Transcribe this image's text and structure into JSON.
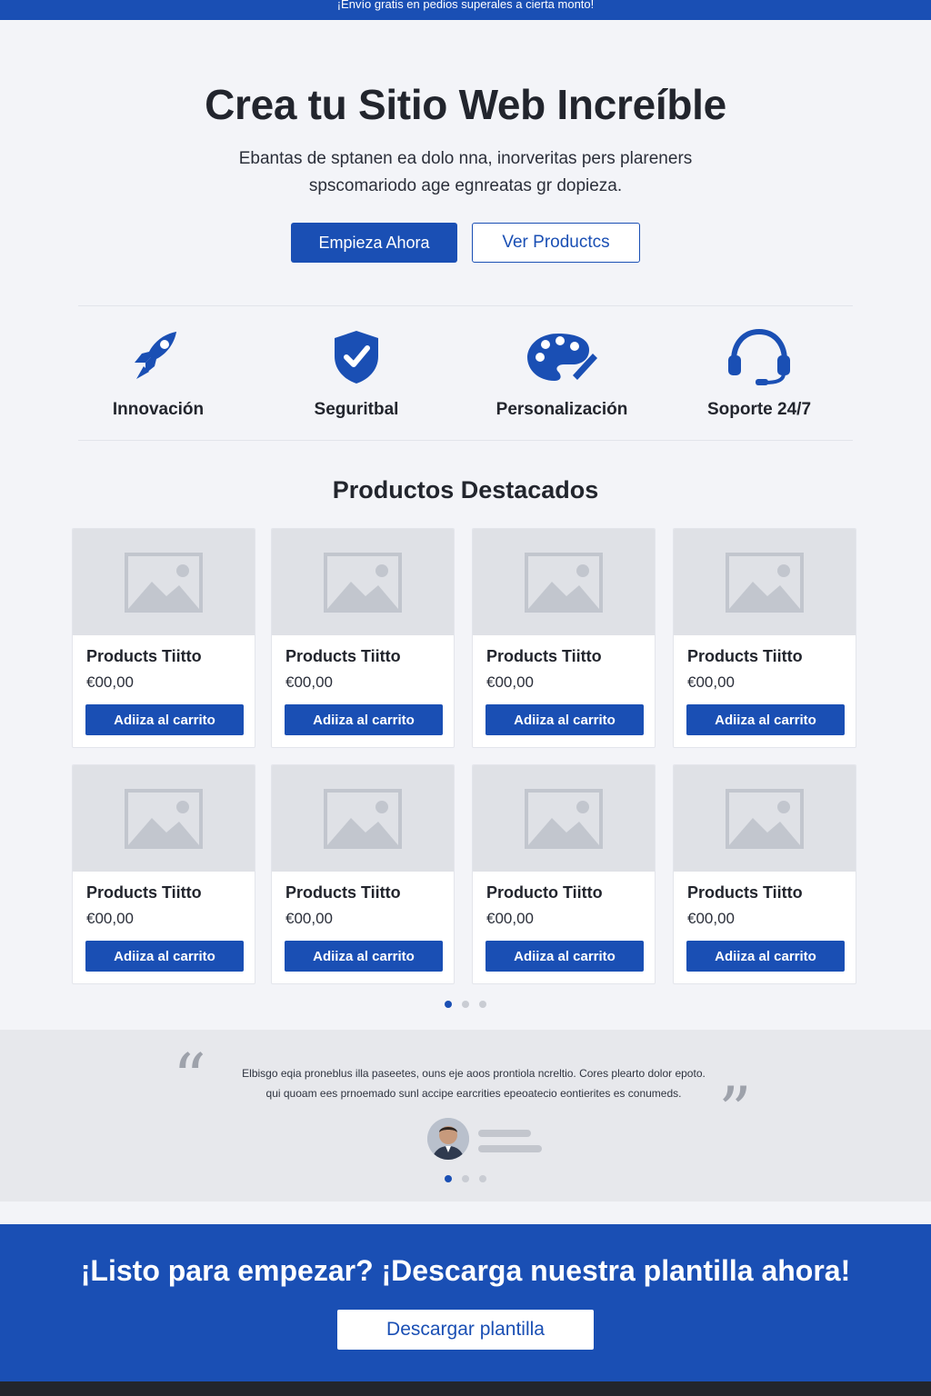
{
  "announcement": "¡Envío gratis en pedios superales a cierta monto!",
  "hero": {
    "title": "Crea tu Sitio Web Increíble",
    "subtitle_line1": "Ebantas de sptanen ea dolo nna, inorveritas pers plareners",
    "subtitle_line2": "spscomariodo age egnreatas gr dopieza.",
    "primary_button": "Empieza Ahora",
    "secondary_button": "Ver Productcs"
  },
  "features": [
    {
      "label": "Innovación",
      "icon": "rocket-icon"
    },
    {
      "label": "Seguritbal",
      "icon": "shield-check-icon"
    },
    {
      "label": "Personalización",
      "icon": "palette-icon"
    },
    {
      "label": "Soporte 24/7",
      "icon": "headset-icon"
    }
  ],
  "products_section": {
    "title": "Productos Destacados",
    "items": [
      {
        "name": "Products Tiitto",
        "price": "€00,00",
        "button": "Adiiza al carrito"
      },
      {
        "name": "Products Tiitto",
        "price": "€00,00",
        "button": "Adiiza al carrito"
      },
      {
        "name": "Products Tiitto",
        "price": "€00,00",
        "button": "Adiiza al carrito"
      },
      {
        "name": "Products Tiitto",
        "price": "€00,00",
        "button": "Adiiza al carrito"
      },
      {
        "name": "Products Tiitto",
        "price": "€00,00",
        "button": "Adiiza al carrito"
      },
      {
        "name": "Products Tiitto",
        "price": "€00,00",
        "button": "Adiiza al carrito"
      },
      {
        "name": "Producto Tiitto",
        "price": "€00,00",
        "button": "Adiiza al carrito"
      },
      {
        "name": "Products Tiitto",
        "price": "€00,00",
        "button": "Adiiza al carrito"
      }
    ],
    "pagination_pages": 3,
    "active_page": 1
  },
  "testimonial": {
    "text_line1": "Elbisgo eqia proneblus illa paseetes, ouns eje aoos prontiola ncreltio. Cores plearto dolor epoto.",
    "text_line2": "qui quoam ees prnoemado sunl accipe earcrities epeoatecio eontierites es conumeds.",
    "pagination_pages": 3,
    "active_page": 1
  },
  "cta": {
    "title": "¡Listo para empezar? ¡Descarga nuestra plantilla ahora!",
    "button": "Descargar plantilla"
  },
  "colors": {
    "brand_blue": "#1a4fb4",
    "background": "#f3f4f8",
    "placeholder_gray": "#dfe1e6",
    "footer": "#22252c"
  }
}
